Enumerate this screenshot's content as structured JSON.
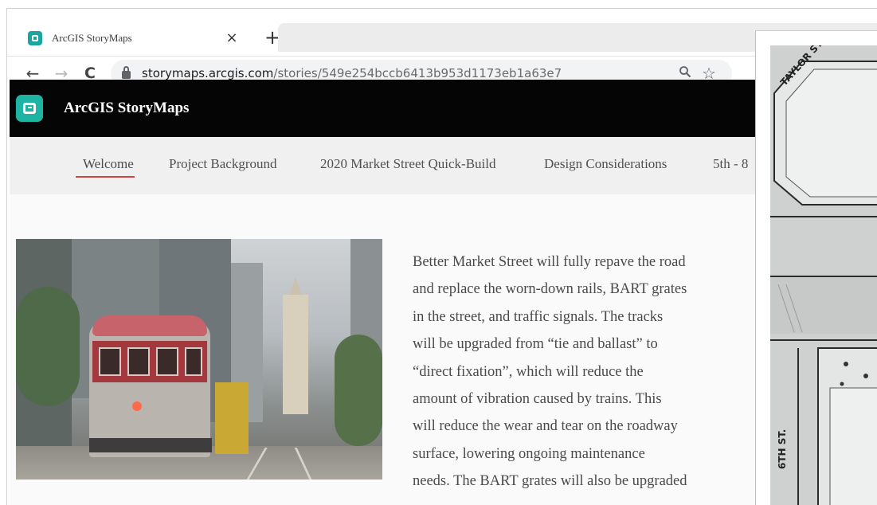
{
  "browser": {
    "tab": {
      "title": "ArcGIS StoryMaps",
      "close_glyph": "×"
    },
    "new_tab_glyph": "+",
    "toolbar": {
      "back_glyph": "←",
      "forward_glyph": "→",
      "reload_glyph": "C",
      "url_host": "storymaps.arcgis.com",
      "url_path": "/stories/549e254bccb6413b953d1173eb1a63e7",
      "zoom_glyph": "🔍",
      "star_glyph": "☆"
    }
  },
  "app": {
    "name": "ArcGIS StoryMaps",
    "brand_color": "#1fb3a4"
  },
  "story_nav": {
    "items": [
      {
        "label": "Welcome",
        "active": true
      },
      {
        "label": "Project Background",
        "active": false
      },
      {
        "label": "2020 Market Street Quick-Build",
        "active": false
      },
      {
        "label": "Design Considerations",
        "active": false
      },
      {
        "label": "5th - 8",
        "active": false
      }
    ],
    "active_color": "#cc4444"
  },
  "story": {
    "hero_image": "market-street-streetcar-photo",
    "lines": [
      "Better Market Street will fully repave the road",
      "and replace the worn-down rails, BART grates",
      "in the street, and traffic signals. The tracks",
      "will be upgraded from “tie and ballast” to",
      "“direct fixation”, which will reduce the",
      "amount of vibration caused by trains. This",
      "will reduce the wear and tear on the roadway",
      "surface, lowering ongoing maintenance",
      "needs. The BART grates will also be upgraded"
    ]
  },
  "map": {
    "street_labels": [
      "TAYLOR ST",
      "6TH ST."
    ]
  }
}
